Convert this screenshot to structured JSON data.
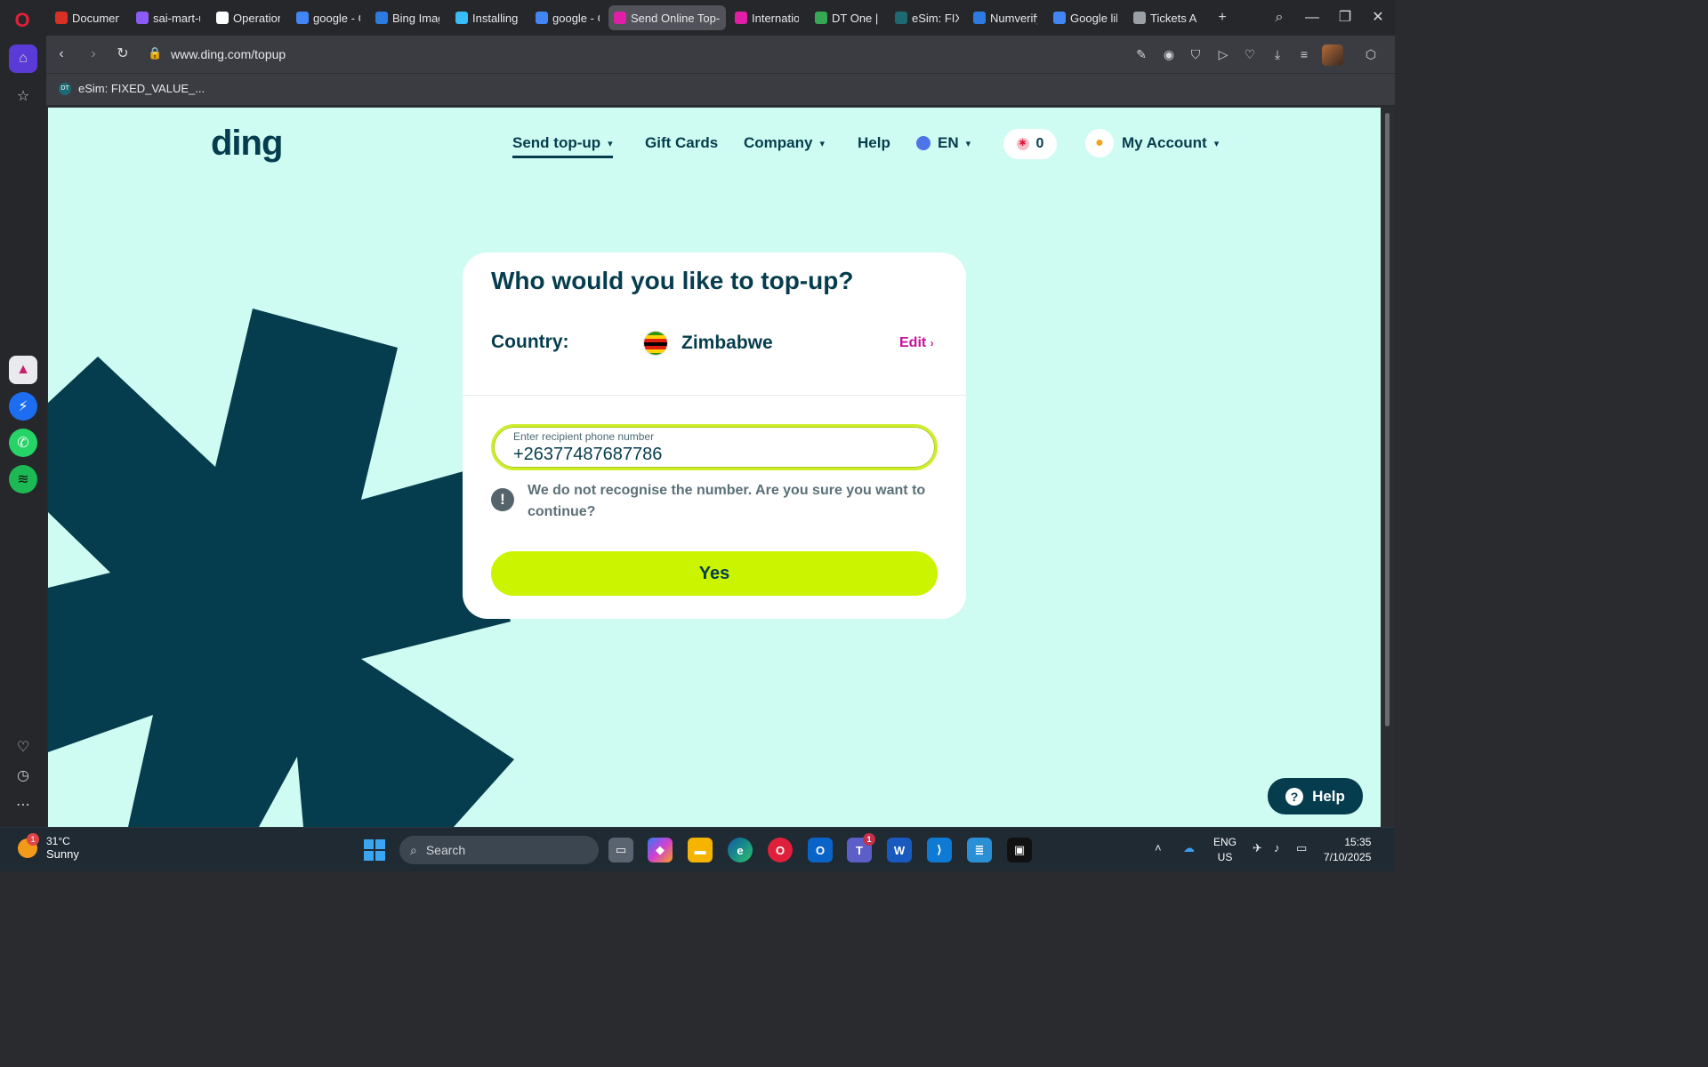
{
  "browser": {
    "tabs": [
      {
        "label": "Document",
        "color": "#d93025"
      },
      {
        "label": "sai-mart-ui",
        "color": "#8a5cf5"
      },
      {
        "label": "Operationa",
        "color": "#ffffff"
      },
      {
        "label": "google - G",
        "color": "#4285f4"
      },
      {
        "label": "Bing Image",
        "color": "#2d7be0"
      },
      {
        "label": "Installing T",
        "color": "#38bdf8"
      },
      {
        "label": "google - G",
        "color": "#4285f4"
      },
      {
        "label": "Send Online Top-u",
        "color": "#e21ea8"
      },
      {
        "label": "Internation",
        "color": "#e21ea8"
      },
      {
        "label": "DT One | M",
        "color": "#34a853"
      },
      {
        "label": "eSim: FIXEI",
        "color": "#1e6a72"
      },
      {
        "label": "Numverify",
        "color": "#2d7be0"
      },
      {
        "label": "Google lib",
        "color": "#4285f4"
      },
      {
        "label": "Tickets Arc",
        "color": "#9aa0a6"
      }
    ],
    "url": "www.ding.com/topup",
    "bookmark": "eSim: FIXED_VALUE_..."
  },
  "site": {
    "logo": "ding",
    "nav": {
      "send_topup": "Send top-up",
      "gift_cards": "Gift Cards",
      "company": "Company",
      "help": "Help",
      "language": "EN",
      "rewards_count": "0",
      "my_account": "My Account"
    }
  },
  "topup_card": {
    "title": "Who would you like to top-up?",
    "country_label": "Country:",
    "country_name": "Zimbabwe",
    "edit_label": "Edit",
    "phone_label": "Enter recipient phone number",
    "phone_value": "+26377487687786",
    "warning": "We do not recognise the number. Are you sure you want to continue?",
    "confirm_button": "Yes"
  },
  "help_button": "Help",
  "taskbar": {
    "weather_temp": "31°C",
    "weather_desc": "Sunny",
    "weather_badge": "1",
    "search_placeholder": "Search",
    "teams_badge": "1",
    "lang_top": "ENG",
    "lang_bottom": "US",
    "time": "15:35",
    "date": "7/10/2025"
  },
  "colors": {
    "brand_dark": "#053d4e",
    "page_bg": "#cffcf2",
    "accent_lime": "#cbf400",
    "edit_magenta": "#c8109c"
  }
}
